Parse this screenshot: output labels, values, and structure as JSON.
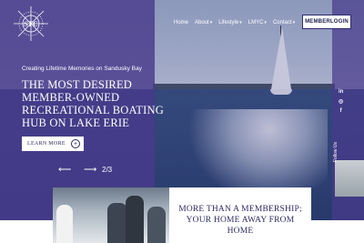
{
  "brand": {
    "logo_text": "STC"
  },
  "nav": {
    "items": [
      {
        "label": "Home",
        "has_caret": false
      },
      {
        "label": "About",
        "has_caret": true
      },
      {
        "label": "Lifestyle",
        "has_caret": true
      },
      {
        "label": "LMYC",
        "has_caret": true
      },
      {
        "label": "Contact",
        "has_caret": true
      }
    ],
    "caret": "▾",
    "login_label": "MEMBERLOGIN"
  },
  "hero": {
    "tagline": "Creating Lifetime Memories on Sandusky Bay",
    "headline": "THE MOST DESIRED MEMBER-OWNED RECREATIONAL BOATING HUB ON LAKE ERIE",
    "cta_label": "LEARN MORE",
    "cta_icon": "+",
    "slider": {
      "prev": "⟵",
      "next": "⟶",
      "pager": "2/3"
    }
  },
  "social": {
    "icons": [
      "in",
      "◎",
      "f"
    ],
    "label": "Follow Us"
  },
  "feature": {
    "title": "MORE THAN A MEMBERSHIP; YOUR HOME AWAY FROM HOME"
  },
  "colors": {
    "overlay": "#483a8c",
    "navy": "#2e2a66",
    "white": "#ffffff"
  }
}
